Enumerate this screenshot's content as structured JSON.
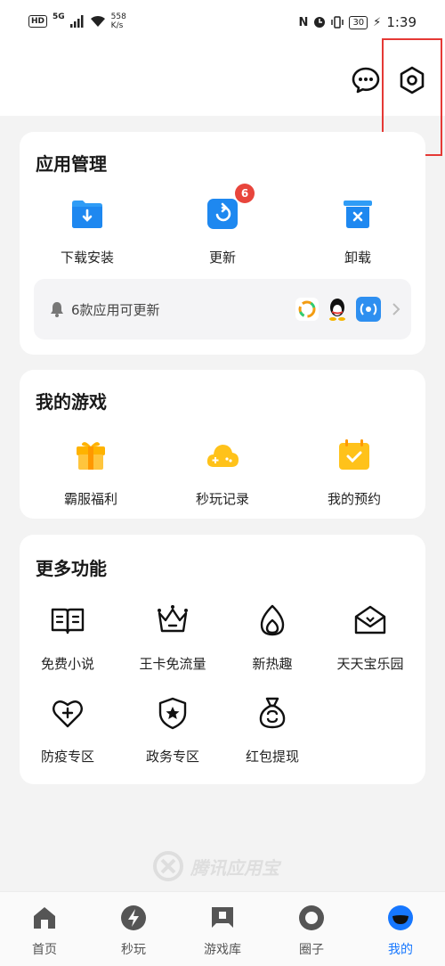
{
  "status_bar": {
    "hd": "HD",
    "signal": "5G",
    "speed_value": "558",
    "speed_unit": "K/s",
    "battery": "30",
    "time": "1:39"
  },
  "sections": {
    "app_management": {
      "title": "应用管理",
      "items": [
        {
          "label": "下载安装",
          "icon": "download-folder-icon"
        },
        {
          "label": "更新",
          "icon": "update-icon",
          "badge": "6"
        },
        {
          "label": "卸载",
          "icon": "uninstall-trash-icon"
        }
      ],
      "update_banner": {
        "text": "6款应用可更新"
      }
    },
    "my_games": {
      "title": "我的游戏",
      "items": [
        {
          "label": "霸服福利",
          "icon": "gift-icon"
        },
        {
          "label": "秒玩记录",
          "icon": "cloud-game-icon"
        },
        {
          "label": "我的预约",
          "icon": "calendar-check-icon"
        }
      ]
    },
    "more_features": {
      "title": "更多功能",
      "items": [
        {
          "label": "免费小说",
          "icon": "book-icon"
        },
        {
          "label": "王卡免流量",
          "icon": "crown-icon"
        },
        {
          "label": "新热趣",
          "icon": "flame-icon"
        },
        {
          "label": "天天宝乐园",
          "icon": "envelope-house-icon"
        },
        {
          "label": "防疫专区",
          "icon": "heart-plus-icon"
        },
        {
          "label": "政务专区",
          "icon": "shield-star-icon"
        },
        {
          "label": "红包提现",
          "icon": "money-bag-icon"
        }
      ]
    }
  },
  "watermark": {
    "text": "腾讯应用宝"
  },
  "bottom_nav": [
    {
      "label": "首页"
    },
    {
      "label": "秒玩"
    },
    {
      "label": "游戏库"
    },
    {
      "label": "圈子"
    },
    {
      "label": "我的",
      "active": true
    }
  ],
  "colors": {
    "accent": "#1677ff",
    "badge": "#e8453c",
    "highlight": "#e53935"
  }
}
